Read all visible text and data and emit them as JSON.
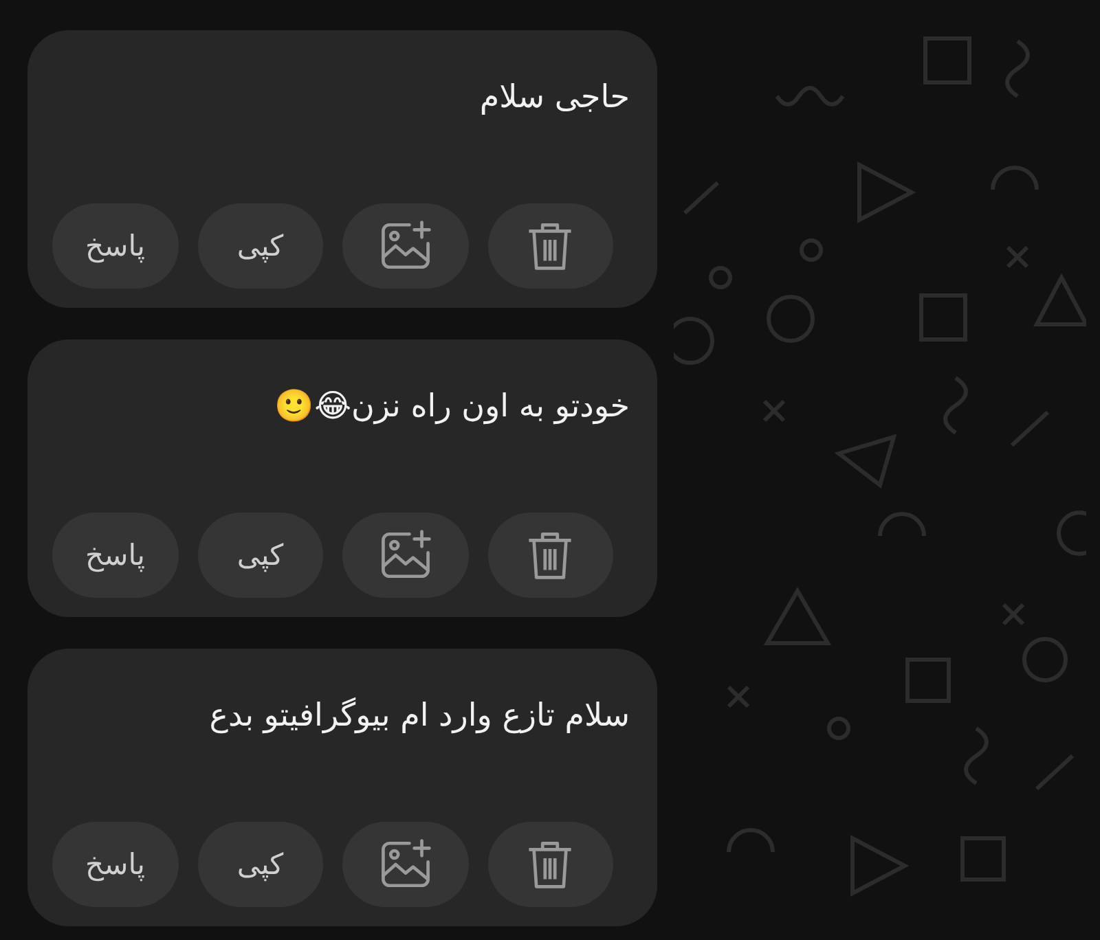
{
  "messages": [
    {
      "text": "حاجی سلام",
      "actions": [
        {
          "kind": "delete"
        },
        {
          "kind": "add-image"
        },
        {
          "kind": "text",
          "label": "کپی"
        },
        {
          "kind": "text",
          "label": "پاسخ"
        }
      ]
    },
    {
      "text": "خودتو به اون راه نزن😂🙂",
      "actions": [
        {
          "kind": "delete"
        },
        {
          "kind": "add-image"
        },
        {
          "kind": "text",
          "label": "کپی"
        },
        {
          "kind": "text",
          "label": "پاسخ"
        }
      ]
    },
    {
      "text": "سلام تازع وارد ام بیوگرافیتو بدع",
      "actions": [
        {
          "kind": "delete"
        },
        {
          "kind": "add-image"
        },
        {
          "kind": "text",
          "label": "کپی"
        },
        {
          "kind": "text",
          "label": "پاسخ"
        }
      ]
    }
  ]
}
